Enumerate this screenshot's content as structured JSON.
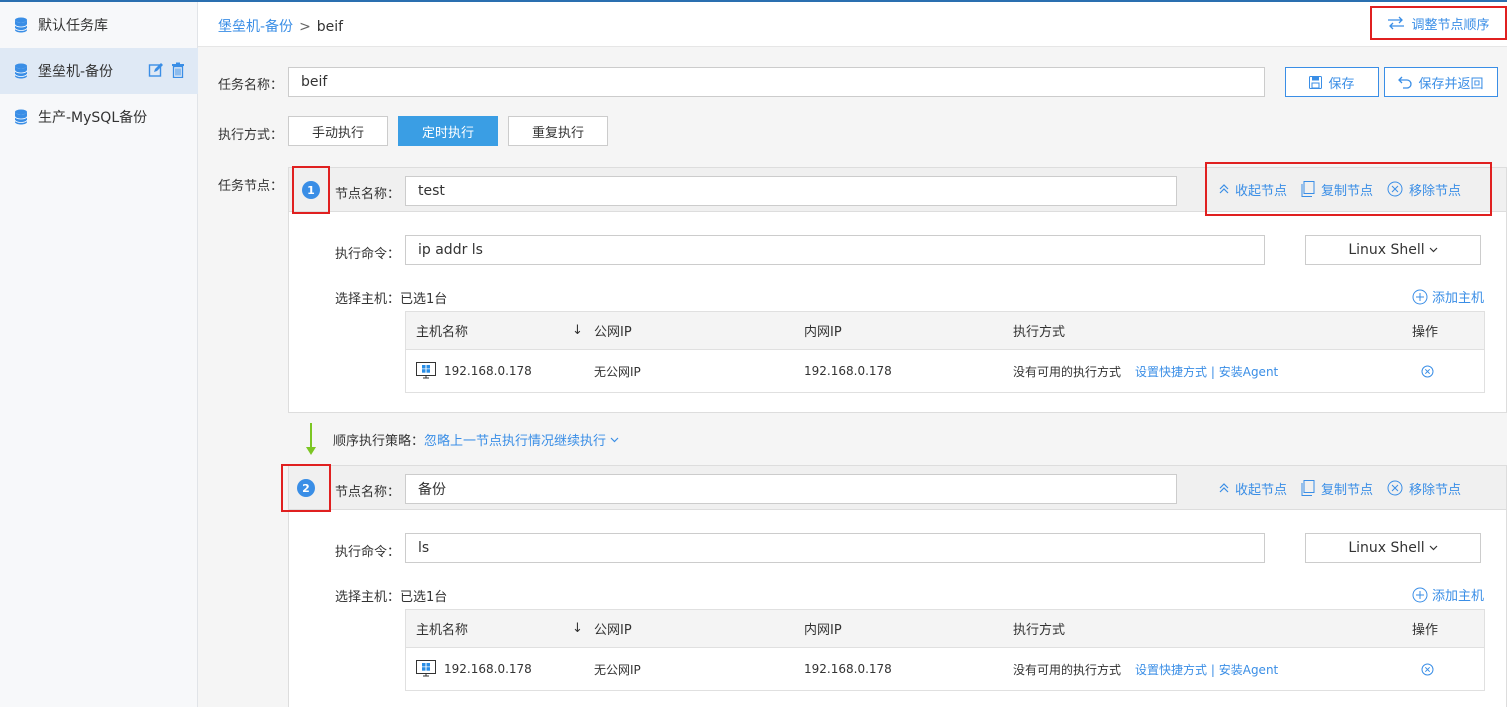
{
  "sidebar": {
    "items": [
      {
        "label": "默认任务库"
      },
      {
        "label": "堡垒机-备份"
      },
      {
        "label": "生产-MySQL备份"
      }
    ]
  },
  "header": {
    "breadcrumb_parent": "堡垒机-备份",
    "breadcrumb_sep": ">",
    "breadcrumb_current": "beif",
    "adjust_label": "调整节点顺序"
  },
  "form": {
    "task_name_label": "任务名称：",
    "task_name_value": "beif",
    "save_label": "保存",
    "save_return_label": "保存并返回",
    "exec_mode_label": "执行方式：",
    "exec_modes": [
      "手动执行",
      "定时执行",
      "重复执行"
    ],
    "task_nodes_label": "任务节点："
  },
  "nodes": [
    {
      "number": "1",
      "name_label": "节点名称：",
      "name_value": "test",
      "collapse_label": "收起节点",
      "copy_label": "复制节点",
      "remove_label": "移除节点",
      "cmd_label": "执行命令：",
      "cmd_value": "ip addr ls",
      "shell": "Linux Shell",
      "host_label": "选择主机：已选1台",
      "add_host_label": "添加主机",
      "table_headers": [
        "主机名称",
        "公网IP",
        "内网IP",
        "执行方式",
        "操作"
      ],
      "rows": [
        {
          "host": "192.168.0.178",
          "public_ip": "无公网IP",
          "private_ip": "192.168.0.178",
          "exec": "没有可用的执行方式",
          "link1": "设置快捷方式",
          "link_sep": "|",
          "link2": "安装Agent"
        }
      ]
    },
    {
      "number": "2",
      "name_label": "节点名称：",
      "name_value": "备份",
      "collapse_label": "收起节点",
      "copy_label": "复制节点",
      "remove_label": "移除节点",
      "cmd_label": "执行命令：",
      "cmd_value": "ls",
      "shell": "Linux Shell",
      "host_label": "选择主机：已选1台",
      "add_host_label": "添加主机",
      "table_headers": [
        "主机名称",
        "公网IP",
        "内网IP",
        "执行方式",
        "操作"
      ],
      "rows": [
        {
          "host": "192.168.0.178",
          "public_ip": "无公网IP",
          "private_ip": "192.168.0.178",
          "exec": "没有可用的执行方式",
          "link1": "设置快捷方式",
          "link_sep": "|",
          "link2": "安装Agent"
        }
      ]
    }
  ],
  "strategy": {
    "label": "顺序执行策略：",
    "value": "忽略上一节点执行情况继续执行"
  },
  "colors": {
    "accent": "#3a8ee6",
    "primary_button": "#3a9ee4",
    "highlight_box": "#e02020",
    "arrow_green": "#7cc623"
  }
}
